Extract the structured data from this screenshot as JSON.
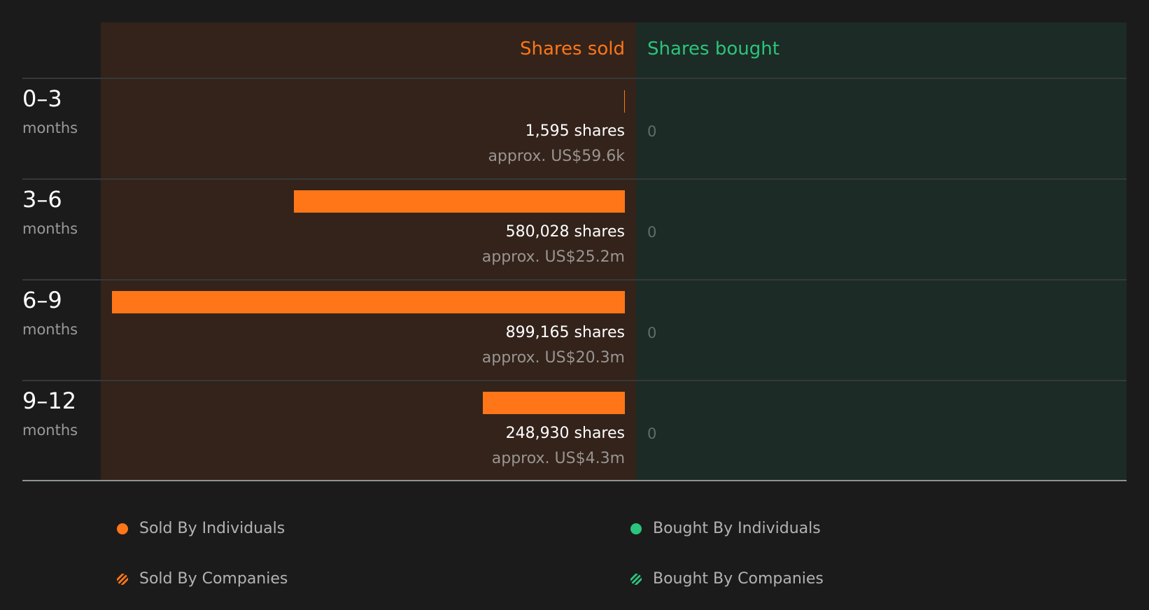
{
  "chart_data": {
    "type": "bar",
    "title": "",
    "columns": {
      "sold": "Shares sold",
      "bought": "Shares bought"
    },
    "colors": {
      "sold": "#fe7617",
      "bought": "#2bc47c"
    },
    "unit_label": "months",
    "rows": [
      {
        "period": "0–3",
        "sold_shares": 1595,
        "sold_label": "1,595 shares",
        "sold_value": "approx. US$59.6k",
        "bought_shares": 0,
        "bought_label": "0"
      },
      {
        "period": "3–6",
        "sold_shares": 580028,
        "sold_label": "580,028 shares",
        "sold_value": "approx. US$25.2m",
        "bought_shares": 0,
        "bought_label": "0"
      },
      {
        "period": "6–9",
        "sold_shares": 899165,
        "sold_label": "899,165 shares",
        "sold_value": "approx. US$20.3m",
        "bought_shares": 0,
        "bought_label": "0"
      },
      {
        "period": "9–12",
        "sold_shares": 248930,
        "sold_label": "248,930 shares",
        "sold_value": "approx. US$4.3m",
        "bought_shares": 0,
        "bought_label": "0"
      }
    ],
    "legend": [
      {
        "label": "Sold By Individuals",
        "color": "#fe7617",
        "marker": "dot"
      },
      {
        "label": "Bought By Individuals",
        "color": "#2bc47c",
        "marker": "dot"
      },
      {
        "label": "Sold By Companies",
        "color": "#fe7617",
        "marker": "hatched-dot"
      },
      {
        "label": "Bought By Companies",
        "color": "#2bc47c",
        "marker": "hatched-dot"
      }
    ]
  }
}
